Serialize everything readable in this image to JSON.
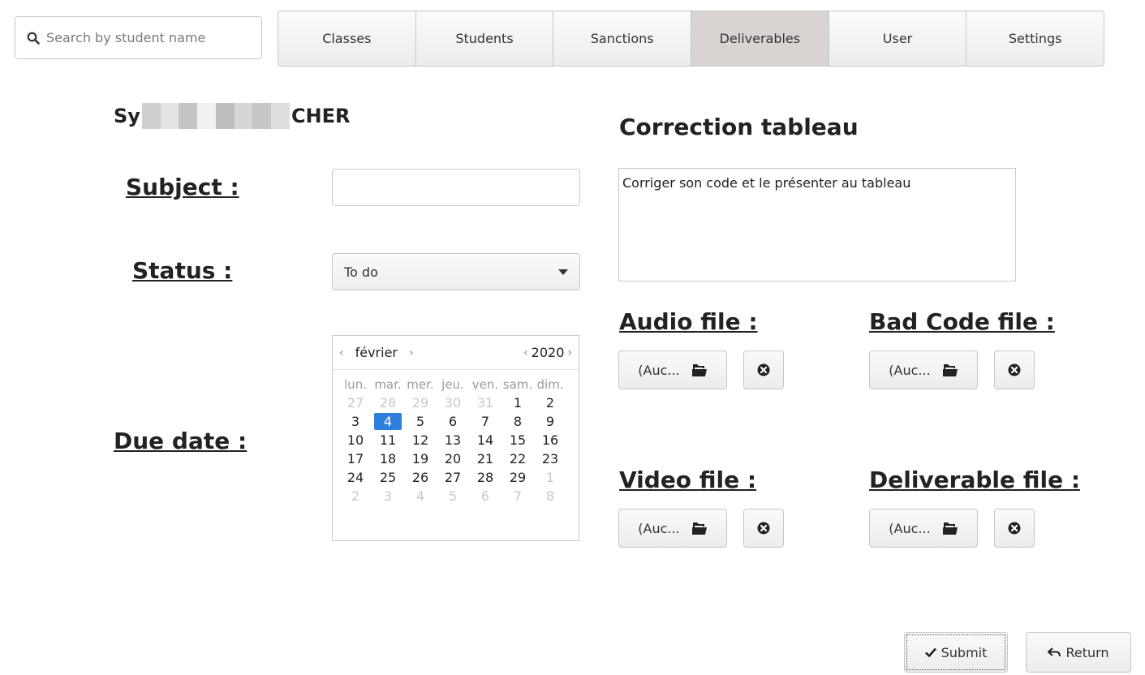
{
  "search": {
    "placeholder": "Search by student name"
  },
  "tabs": [
    {
      "label": "Classes",
      "active": false
    },
    {
      "label": "Students",
      "active": false
    },
    {
      "label": "Sanctions",
      "active": false
    },
    {
      "label": "Deliverables",
      "active": true
    },
    {
      "label": "User",
      "active": false
    },
    {
      "label": "Settings",
      "active": false
    }
  ],
  "student": {
    "name_start": "Sy",
    "name_end": "CHER"
  },
  "form": {
    "subject_label": "Subject :",
    "subject_value": "",
    "status_label": "Status :",
    "status_value": "To do",
    "due_date_label": "Due date :"
  },
  "calendar": {
    "month": "février",
    "year": "2020",
    "prev_month_icon": "‹",
    "next_month_icon": "›",
    "weekdays": [
      "lun.",
      "mar.",
      "mer.",
      "jeu.",
      "ven.",
      "sam.",
      "dim."
    ],
    "weeks": [
      [
        "27",
        "28",
        "29",
        "30",
        "31",
        "1",
        "2"
      ],
      [
        "3",
        "4",
        "5",
        "6",
        "7",
        "8",
        "9"
      ],
      [
        "10",
        "11",
        "12",
        "13",
        "14",
        "15",
        "16"
      ],
      [
        "17",
        "18",
        "19",
        "20",
        "21",
        "22",
        "23"
      ],
      [
        "24",
        "25",
        "26",
        "27",
        "28",
        "29",
        "1"
      ],
      [
        "2",
        "3",
        "4",
        "5",
        "6",
        "7",
        "8"
      ]
    ],
    "selected": "4"
  },
  "deliverable": {
    "title": "Correction tableau",
    "description": "Corriger son code et le présenter au tableau"
  },
  "files": {
    "audio_label": "Audio file :",
    "bad_code_label": "Bad Code file :",
    "video_label": "Video file :",
    "deliverable_label": "Deliverable file :",
    "empty_text": "(Auc..."
  },
  "actions": {
    "submit": "Submit",
    "return": "Return"
  },
  "colors": {
    "active_tab": "#d9d4d1",
    "selected_day": "#2f7fdc"
  }
}
